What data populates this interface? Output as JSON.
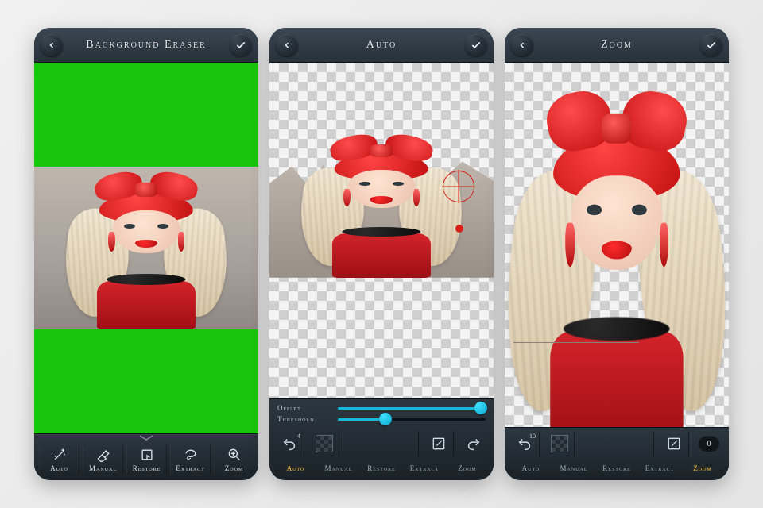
{
  "screens": [
    {
      "title": "Background Eraser",
      "back": true,
      "confirm": true,
      "mode": "initial",
      "toolbar": {
        "items": [
          {
            "key": "auto",
            "label": "Auto"
          },
          {
            "key": "manual",
            "label": "Manual"
          },
          {
            "key": "restore",
            "label": "Restore"
          },
          {
            "key": "extract",
            "label": "Extract"
          },
          {
            "key": "zoom",
            "label": "Zoom"
          }
        ]
      }
    },
    {
      "title": "Auto",
      "back": true,
      "confirm": true,
      "mode": "auto",
      "sliders": {
        "offset": {
          "label": "Offset",
          "value": 0.97
        },
        "threshold": {
          "label": "Threshold",
          "value": 0.32
        }
      },
      "controls": {
        "undo_count": 4,
        "redo_enabled": true
      },
      "tabs": {
        "items": [
          "Auto",
          "Manual",
          "Restore",
          "Extract",
          "Zoom"
        ],
        "active": "Auto"
      }
    },
    {
      "title": "Zoom",
      "back": true,
      "confirm": true,
      "mode": "zoom",
      "controls": {
        "undo_count": 10,
        "step_value": 0,
        "redo_enabled": true
      },
      "tabs": {
        "items": [
          "Auto",
          "Manual",
          "Restore",
          "Extract",
          "Zoom"
        ],
        "active": "Zoom"
      }
    }
  ],
  "icons": {
    "back": "chevron-left-icon",
    "confirm": "check-icon",
    "auto": "magic-wand-icon",
    "manual": "eraser-icon",
    "restore": "restore-icon",
    "extract": "lasso-icon",
    "zoom": "magnifier-plus-icon",
    "undo": "undo-icon",
    "redo": "redo-icon",
    "transparency": "transparency-swatch-icon",
    "edit": "edit-square-icon",
    "collapse": "chevron-down-icon"
  },
  "colors": {
    "chrome_bg": "#263238",
    "green_screen": "#18c60c",
    "accent_red": "#d7201a",
    "slider": "#17b8e0",
    "tab_active": "#f3bb3c"
  }
}
